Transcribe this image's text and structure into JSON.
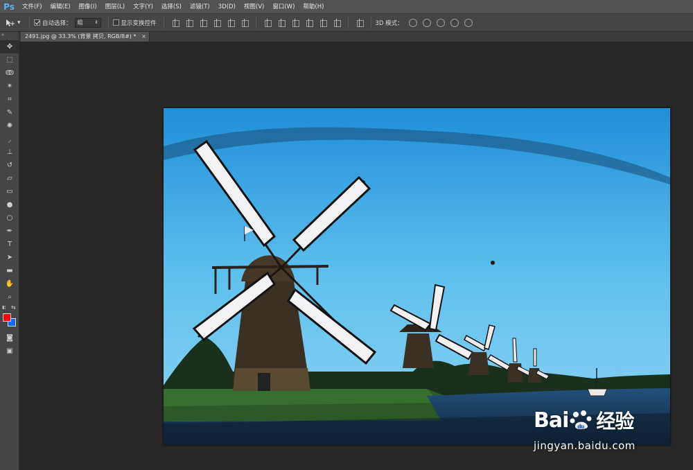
{
  "app": {
    "logo": "Ps"
  },
  "menu": [
    "文件(F)",
    "编辑(E)",
    "图像(I)",
    "图层(L)",
    "文字(Y)",
    "选择(S)",
    "滤镜(T)",
    "3D(D)",
    "视图(V)",
    "窗口(W)",
    "帮助(H)"
  ],
  "options": {
    "auto_select_label": "自动选择：",
    "auto_select_value": "组",
    "show_transform_label": "显示变换控件",
    "mode3d_label": "3D 模式："
  },
  "document": {
    "tab_title": "2491.jpg @ 33.3% (背景 拷贝, RGB/8#) *",
    "close_glyph": "×"
  },
  "tools": [
    {
      "icon": "move-tool-icon",
      "glyph": "✥"
    },
    {
      "icon": "marquee-tool-icon",
      "glyph": "⬚"
    },
    {
      "icon": "lasso-tool-icon",
      "glyph": "ↂ"
    },
    {
      "icon": "magic-wand-tool-icon",
      "glyph": "✶"
    },
    {
      "icon": "crop-tool-icon",
      "glyph": "⌗"
    },
    {
      "icon": "eyedropper-tool-icon",
      "glyph": "✎"
    },
    {
      "icon": "healing-brush-tool-icon",
      "glyph": "✺"
    },
    {
      "icon": "brush-tool-icon",
      "glyph": "⸝"
    },
    {
      "icon": "stamp-tool-icon",
      "glyph": "⊥"
    },
    {
      "icon": "history-brush-tool-icon",
      "glyph": "↺"
    },
    {
      "icon": "eraser-tool-icon",
      "glyph": "▱"
    },
    {
      "icon": "gradient-tool-icon",
      "glyph": "▭"
    },
    {
      "icon": "blur-tool-icon",
      "glyph": "●"
    },
    {
      "icon": "dodge-tool-icon",
      "glyph": "○"
    },
    {
      "icon": "pen-tool-icon",
      "glyph": "✒"
    },
    {
      "icon": "type-tool-icon",
      "glyph": "T"
    },
    {
      "icon": "path-selection-tool-icon",
      "glyph": "➤"
    },
    {
      "icon": "shape-tool-icon",
      "glyph": "▬"
    },
    {
      "icon": "hand-tool-icon",
      "glyph": "✋"
    },
    {
      "icon": "zoom-tool-icon",
      "glyph": "⌕"
    }
  ],
  "colors": {
    "foreground": "#ff0000",
    "background": "#0a6cff"
  },
  "watermark": {
    "brand_latin": "Bai",
    "brand_latin2": "du",
    "brand_cn": "经验",
    "url": "jingyan.baidu.com"
  }
}
